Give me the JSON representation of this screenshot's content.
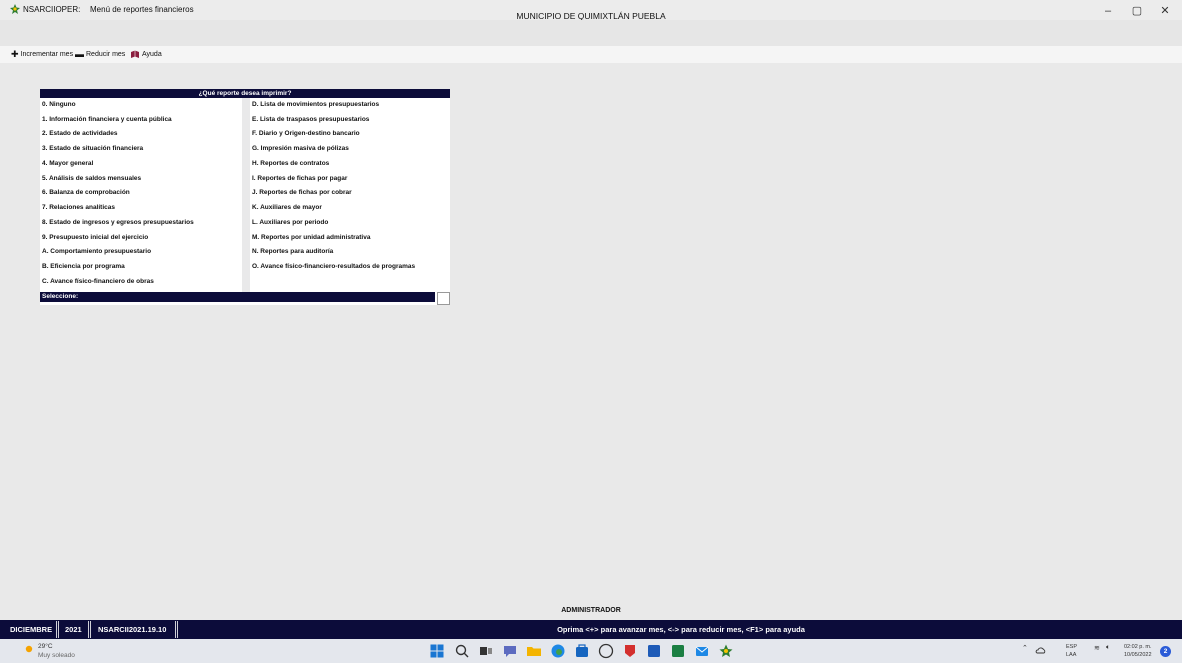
{
  "window": {
    "app_name": "NSARCIIOPER:",
    "window_title": "Menú de reportes financieros",
    "org_title": "MUNICIPIO DE QUIMIXTLÁN PUEBLA",
    "minimize": "–",
    "maximize": "▢",
    "close": "✕"
  },
  "toolbar": {
    "increase": "Incrementar mes",
    "decrease": "Reducir mes",
    "help": "Ayuda"
  },
  "menu": {
    "header": "¿Qué reporte desea imprimir?",
    "left": [
      "0. Ninguno",
      "1. Información financiera y cuenta pública",
      "2. Estado de actividades",
      "3. Estado de situación financiera",
      "4. Mayor general",
      "5. Análisis de saldos mensuales",
      "6. Balanza de comprobación",
      "7. Relaciones analíticas",
      "8. Estado de ingresos y egresos presupuestarios",
      "9. Presupuesto inicial del ejercicio",
      "A. Comportamiento presupuestario",
      "B. Eficiencia por programa",
      "C. Avance físico-financiero de obras"
    ],
    "right": [
      "D. Lista de movimientos presupuestarios",
      "E. Lista de traspasos presupuestarios",
      "F. Diario y Origen-destino bancario",
      "G. Impresión masiva de pólizas",
      "H. Reportes de contratos",
      "I. Reportes de fichas por pagar",
      "J. Reportes de fichas por cobrar",
      "K. Auxiliares de mayor",
      "L. Auxiliares por periodo",
      "M. Reportes por unidad administrativa",
      "N. Reportes para auditoría",
      "O. Avance físico-financiero-resultados de programas"
    ],
    "select_label": "Seleccione:"
  },
  "footer": {
    "user": "ADMINISTRADOR",
    "month": "DICIEMBRE",
    "year": "2021",
    "version": "NSARCII2021.19.10",
    "message": "Oprima <+> para avanzar mes, <-> para reducir mes, <F1> para ayuda"
  },
  "taskbar": {
    "temperature": "29°C",
    "weather": "Muy soleado",
    "lang_top": "ESP",
    "lang_bottom": "LAA",
    "time": "02:02 p. m.",
    "date": "10/05/2022",
    "notifications": "2"
  },
  "colors": {
    "navy": "#0c0c3a",
    "background": "#e9e9e9"
  }
}
